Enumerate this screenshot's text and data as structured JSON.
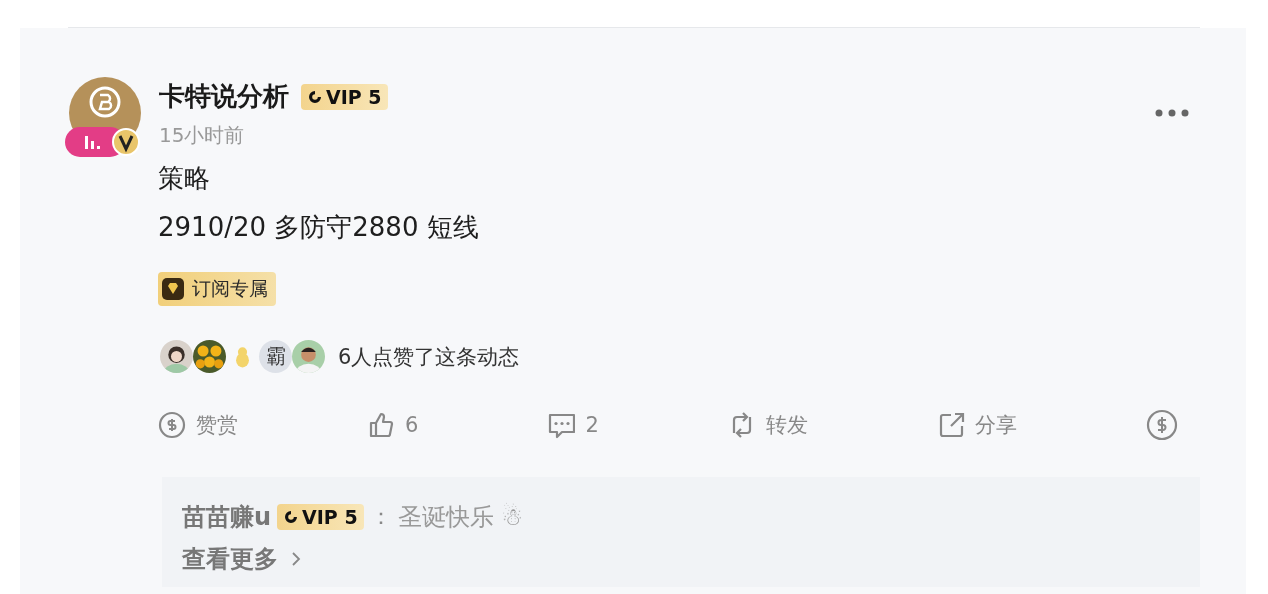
{
  "post": {
    "author": "卡特说分析",
    "vip": "VIP 5",
    "time": "15小时前",
    "lines": [
      "策略",
      "2910/20 多防守2880 短线"
    ],
    "tag": "订阅专属",
    "likers": [
      {
        "kind": "picture"
      },
      {
        "kind": "picture"
      },
      {
        "kind": "picture"
      },
      {
        "kind": "text",
        "text": "霸"
      },
      {
        "kind": "picture"
      }
    ],
    "likes_text": "6人点赞了这条动态",
    "actions": [
      {
        "kind": "reward",
        "label": "赞赏"
      },
      {
        "kind": "like",
        "label": "6"
      },
      {
        "kind": "comment",
        "label": "2"
      },
      {
        "kind": "repost",
        "label": "转发"
      },
      {
        "kind": "share",
        "label": "分享"
      },
      {
        "kind": "tip"
      }
    ],
    "comment": {
      "author": "苗苗赚u",
      "vip": "VIP 5",
      "separator": "：",
      "text": "圣诞快乐 ☃",
      "more": "查看更多"
    }
  }
}
